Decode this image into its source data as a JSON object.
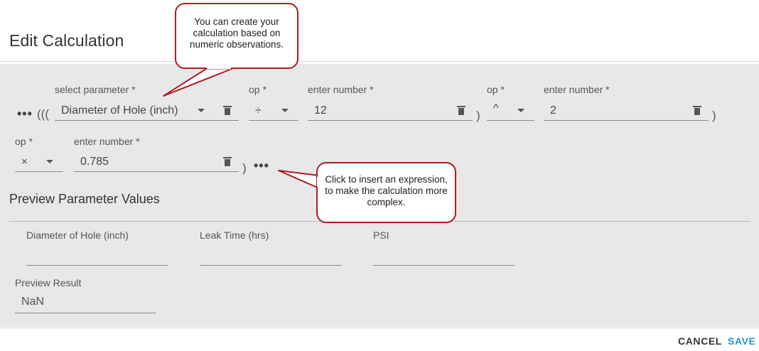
{
  "dialog": {
    "title": "Edit Calculation"
  },
  "expression": {
    "row1": {
      "more_icon": "•••",
      "open_paren": "(((",
      "parameter": {
        "label": "select parameter *",
        "value": "Diameter of Hole (inch)"
      },
      "op1": {
        "label": "op *",
        "value": "÷"
      },
      "number1": {
        "label": "enter number *",
        "value": "12"
      },
      "close_paren1": ")",
      "op2": {
        "label": "op *",
        "value": "^"
      },
      "number2": {
        "label": "enter number *",
        "value": "2"
      },
      "close_paren2": ")"
    },
    "row2": {
      "op3": {
        "label": "op *",
        "value": "×"
      },
      "number3": {
        "label": "enter number *",
        "value": "0.785"
      },
      "close_paren3": ")",
      "more_icon": "•••"
    }
  },
  "preview": {
    "title": "Preview Parameter Values",
    "parameters": [
      {
        "label": "Diameter of Hole (inch)",
        "value": ""
      },
      {
        "label": "Leak Time (hrs)",
        "value": ""
      },
      {
        "label": "PSI",
        "value": ""
      }
    ],
    "result_label": "Preview Result",
    "result_value": "NaN"
  },
  "actions": {
    "cancel": "CANCEL",
    "save": "SAVE"
  },
  "callouts": {
    "top": "You can create your calculation based on numeric observations.",
    "bottom": "Click to insert an expression, to make the calculation more complex."
  },
  "colors": {
    "accent": "#2196c9",
    "callout_border": "#b11a22",
    "panel_bg": "#e8e8e8"
  }
}
